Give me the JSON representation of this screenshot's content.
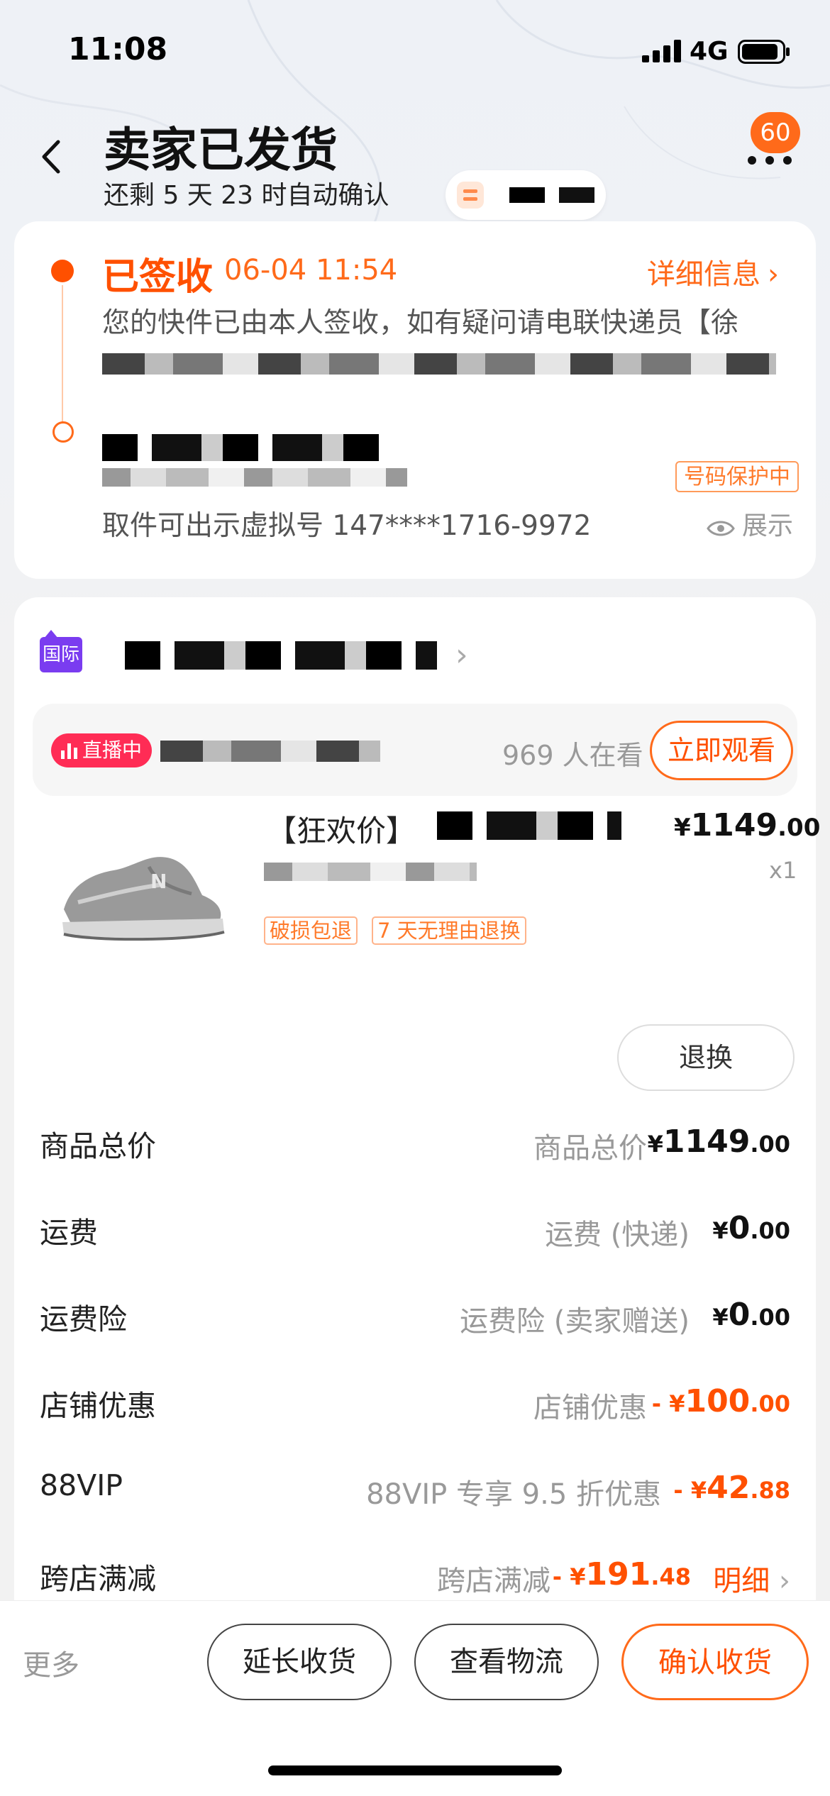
{
  "status": {
    "time": "11:08",
    "network": "4G"
  },
  "header": {
    "title": "卖家已发货",
    "subtitle": "还剩 5 天 23 时自动确认",
    "badge_count": "60"
  },
  "logistics": {
    "status": "已签收",
    "time": "06-04 11:54",
    "detail_link": "详细信息",
    "message": "您的快件已由本人签收，如有疑问请电联快递员【徐",
    "protect_tag": "号码保护中",
    "pickup_text": "取件可出示虚拟号 147****1716-9972",
    "show_label": "展示"
  },
  "shop": {
    "badge": "国际"
  },
  "live": {
    "tag": "直播中",
    "viewers": "969 人在看",
    "watch_button": "立即观看"
  },
  "product": {
    "title_prefix": "【狂欢价】",
    "price_symbol": "¥",
    "price_int": "1149",
    "price_dec": ".00",
    "qty": "x1",
    "tags": [
      "破损包退",
      "7 天无理由退换"
    ],
    "return_button": "退换"
  },
  "summary": [
    {
      "label": "商品总价",
      "sub": "商品总价",
      "prefix": "¥",
      "int": "1149",
      "dec": ".00",
      "red": false
    },
    {
      "label": "运费",
      "sub": "运费 (快递)",
      "prefix": "¥",
      "int": "0",
      "dec": ".00",
      "red": false
    },
    {
      "label": "运费险",
      "sub": "运费险 (卖家赠送)",
      "prefix": "¥",
      "int": "0",
      "dec": ".00",
      "red": false
    },
    {
      "label": "店铺优惠",
      "sub": "店铺优惠",
      "prefix": "- ¥",
      "int": "100",
      "dec": ".00",
      "red": true
    },
    {
      "label": "88VIP",
      "sub": "88VIP 专享 9.5 折优惠",
      "prefix": "- ¥",
      "int": "42",
      "dec": ".88",
      "red": true
    },
    {
      "label": "跨店满减",
      "sub": "跨店满减",
      "prefix": "- ¥",
      "int": "191",
      "dec": ".48",
      "red": true,
      "detail": "明细"
    }
  ],
  "bottom": {
    "more": "更多",
    "extend": "延长收货",
    "track": "查看物流",
    "confirm": "确认收货"
  },
  "colors": {
    "accent": "#ff5000",
    "live": "#ff2c55",
    "shop_badge": "#7a3cf0"
  }
}
